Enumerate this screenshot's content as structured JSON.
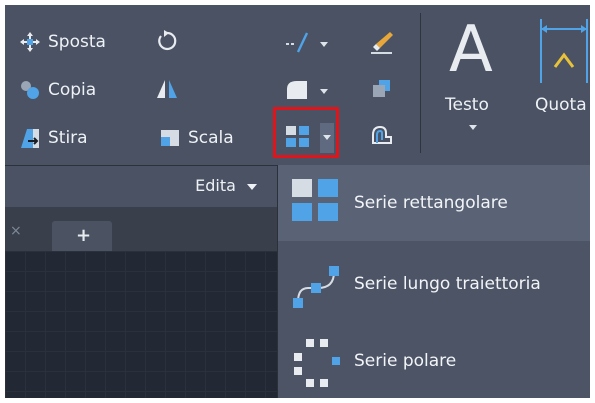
{
  "ribbon": {
    "tools": {
      "move": "Sposta",
      "copy": "Copia",
      "stretch": "Stira",
      "scale": "Scala"
    },
    "annotation": {
      "text": "Testo",
      "dimension": "Quota"
    },
    "panel_title": "Edita"
  },
  "array_menu": {
    "items": [
      {
        "label": "Serie rettangolare",
        "icon": "rectangular-array-icon",
        "selected": true
      },
      {
        "label": "Serie lungo traiettoria",
        "icon": "path-array-icon",
        "selected": false
      },
      {
        "label": "Serie polare",
        "icon": "polar-array-icon",
        "selected": false
      }
    ]
  },
  "colors": {
    "ribbon_bg": "#4a5263",
    "highlight": "#e0151b",
    "icon_blue": "#4fa3e6"
  }
}
